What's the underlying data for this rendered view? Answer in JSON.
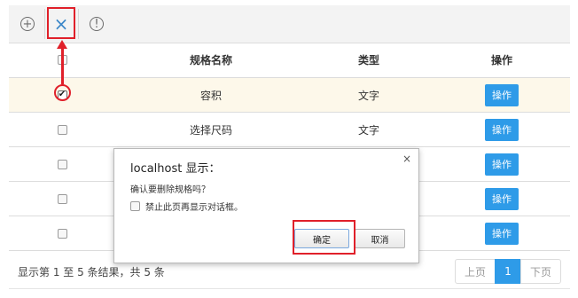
{
  "toolbar": {
    "add_icon": "plus-circle-icon",
    "delete_icon": "close-icon",
    "info_icon": "exclamation-circle-icon",
    "add_glyph": "+",
    "delete_glyph": "×",
    "info_glyph": "!"
  },
  "table": {
    "columns": [
      "规格名称",
      "类型",
      "操作"
    ],
    "rows": [
      {
        "name": "容积",
        "type": "文字",
        "action": "操作",
        "checked": true
      },
      {
        "name": "选择尺码",
        "type": "文字",
        "action": "操作",
        "checked": false
      },
      {
        "name": "",
        "type": "",
        "action": "操作",
        "checked": false
      },
      {
        "name": "",
        "type": "",
        "action": "操作",
        "checked": false
      },
      {
        "name": "",
        "type": "",
        "action": "操作",
        "checked": false
      }
    ]
  },
  "footer": {
    "summary": "显示第 1 至 5 条结果，共 5 条",
    "prev": "上页",
    "current_page": "1",
    "next": "下页"
  },
  "dialog": {
    "title": "localhost 显示：",
    "close": "×",
    "message": "确认要删除规格吗？",
    "checkbox_label": "禁止此页再显示对话框。",
    "ok": "确定",
    "cancel": "取消"
  },
  "colors": {
    "accent": "#2e9be8",
    "highlight": "#e0202a",
    "selected_row": "#fdf8ea"
  }
}
